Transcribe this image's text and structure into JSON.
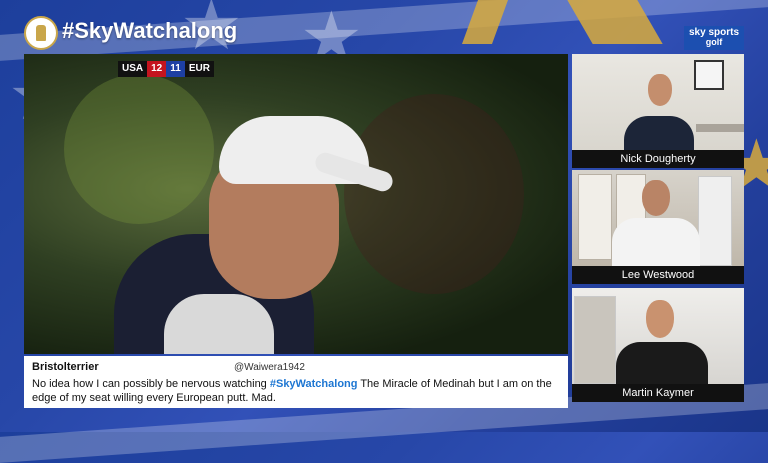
{
  "header": {
    "title": "#SkyWatchalong"
  },
  "brand": {
    "line1": "sky sports",
    "line2": "golf"
  },
  "scorebug": {
    "team1": "USA",
    "score1": "12",
    "score2": "11",
    "team2": "EUR"
  },
  "tweet": {
    "user": "Bristolterrier",
    "handle": "@Waiwera1942",
    "text_before": "No idea how I can possibly be nervous watching ",
    "hashtag": "#SkyWatchalong",
    "text_after": " The Miracle of Medinah but I am on the edge of my seat willing every European putt. Mad."
  },
  "cams": [
    {
      "name": "Nick Dougherty"
    },
    {
      "name": "Lee Westwood"
    },
    {
      "name": "Martin Kaymer"
    }
  ],
  "colors": {
    "usa": "#c4141e",
    "eur": "#1d3fa3",
    "hashtag": "#1d76d2"
  }
}
